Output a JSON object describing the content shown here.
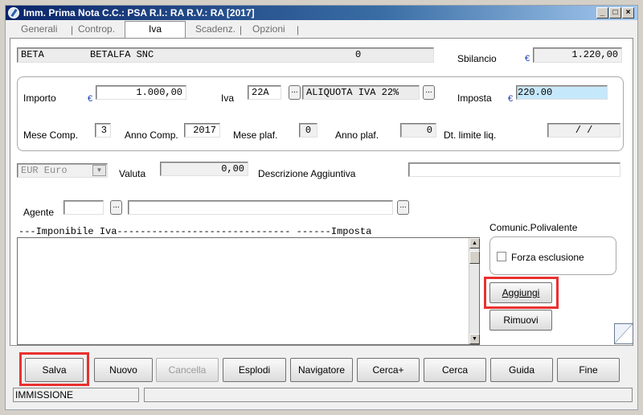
{
  "window": {
    "title": "Imm. Prima Nota C.C.: PSA  R.I.: RA  R.V.: RA  [2017]",
    "controls": {
      "minimize": "_",
      "maximize": "□",
      "close": "×"
    }
  },
  "tabs": [
    {
      "label": "Generali",
      "active": false
    },
    {
      "label": "Controp.",
      "active": false
    },
    {
      "label": "Iva",
      "active": true
    },
    {
      "label": "Scadenz.",
      "active": false
    },
    {
      "label": "Opzioni",
      "active": false
    }
  ],
  "tab_separator": "|",
  "header": {
    "code": "BETA",
    "name": "BETALFA SNC",
    "number": "0",
    "sbilancio_label": "Sbilancio",
    "sbilancio_currency": "€",
    "sbilancio_value": "1.220,00"
  },
  "vat": {
    "importo_label": "Importo",
    "importo_currency": "€",
    "importo_value": "1.000,00",
    "iva_label": "Iva",
    "iva_code": "22A",
    "iva_desc": "ALIQUOTA IVA 22%",
    "imposta_label": "Imposta",
    "imposta_currency": "€",
    "imposta_value": "220.00",
    "mese_comp_label": "Mese Comp.",
    "mese_comp_value": "3",
    "anno_comp_label": "Anno Comp.",
    "anno_comp_value": "2017",
    "mese_plaf_label": "Mese plaf.",
    "mese_plaf_value": "0",
    "anno_plaf_label": "Anno plaf.",
    "anno_plaf_value": "0",
    "dt_limite_label": "Dt. limite liq.",
    "dt_limite_value": "/   /"
  },
  "currency": {
    "selected": "EUR Euro",
    "valuta_label": "Valuta",
    "valuta_value": "0,00",
    "descr_label": "Descrizione Aggiuntiva",
    "descr_value": ""
  },
  "agente": {
    "label": "Agente",
    "code": "",
    "name": ""
  },
  "list": {
    "header": "---Imponibile Iva------------------------------ ------Imposta"
  },
  "comunic": {
    "label": "Comunic.Polivalente",
    "checkbox_label": "Forza esclusione",
    "checked": false
  },
  "side_buttons": {
    "aggiungi": "Aggiungi",
    "rimuovi": "Rimuovi"
  },
  "ellipsis": "...",
  "toolbar": {
    "salva": "Salva",
    "nuovo": "Nuovo",
    "cancella": "Cancella",
    "esplodi": "Esplodi",
    "navigatore": "Navigatore",
    "cerca_plus": "Cerca+",
    "cerca": "Cerca",
    "guida": "Guida",
    "fine": "Fine"
  },
  "status": {
    "mode": "IMMISSIONE",
    "message": ""
  },
  "colors": {
    "highlight": "#e8312f",
    "imposta_field": "#c6e8fb"
  }
}
